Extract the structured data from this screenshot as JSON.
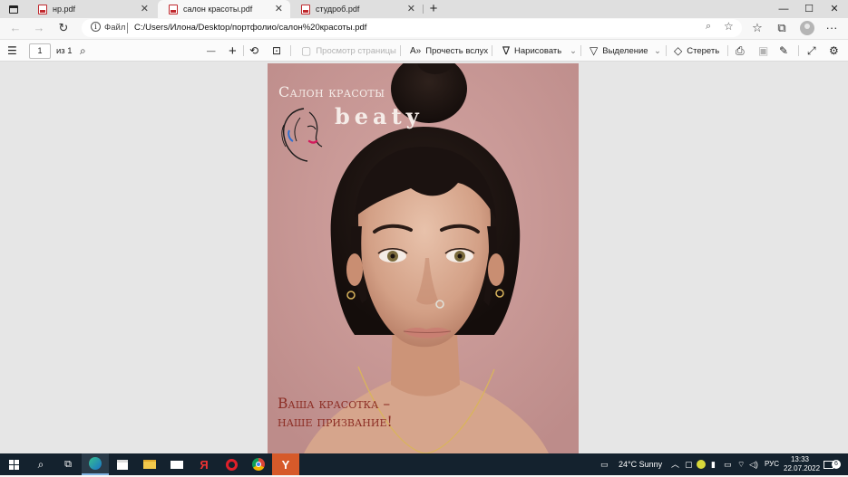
{
  "browser": {
    "tabs": [
      {
        "label": "нр.pdf",
        "active": false
      },
      {
        "label": "салон красоты.pdf",
        "active": true
      },
      {
        "label": "студроб.pdf",
        "active": false
      }
    ],
    "new_tab_glyph": "+",
    "close_glyph": "✕",
    "window_controls": {
      "minimize": "—",
      "maximize": "☐",
      "close": "✕"
    },
    "address": {
      "scheme_label": "Файл",
      "url": "C:/Users/Илона/Desktop/портфолио/салон%20красоты.pdf"
    }
  },
  "pdf_toolbar": {
    "page_number": "1",
    "page_total": "из 1",
    "page_view_label": "Просмотр страницы",
    "read_aloud_label": "Прочесть вслух",
    "draw_label": "Нарисовать",
    "highlight_label": "Выделение",
    "erase_label": "Стереть",
    "zoom_out": "—",
    "zoom_in": "+"
  },
  "document": {
    "heading": "Салон красоты",
    "brand": "beaty",
    "slogan_line1": "Ваша красотка –",
    "slogan_line2": "наше призвание!",
    "colors": {
      "background": "#c99a98",
      "heading": "#f5ece8",
      "slogan": "#8c2d24"
    }
  },
  "taskbar": {
    "weather": "24°C  Sunny",
    "language": "РУС",
    "time": "13:33",
    "date": "22.07.2022",
    "notifications": "6",
    "colors": {
      "background": "#14222e"
    }
  }
}
